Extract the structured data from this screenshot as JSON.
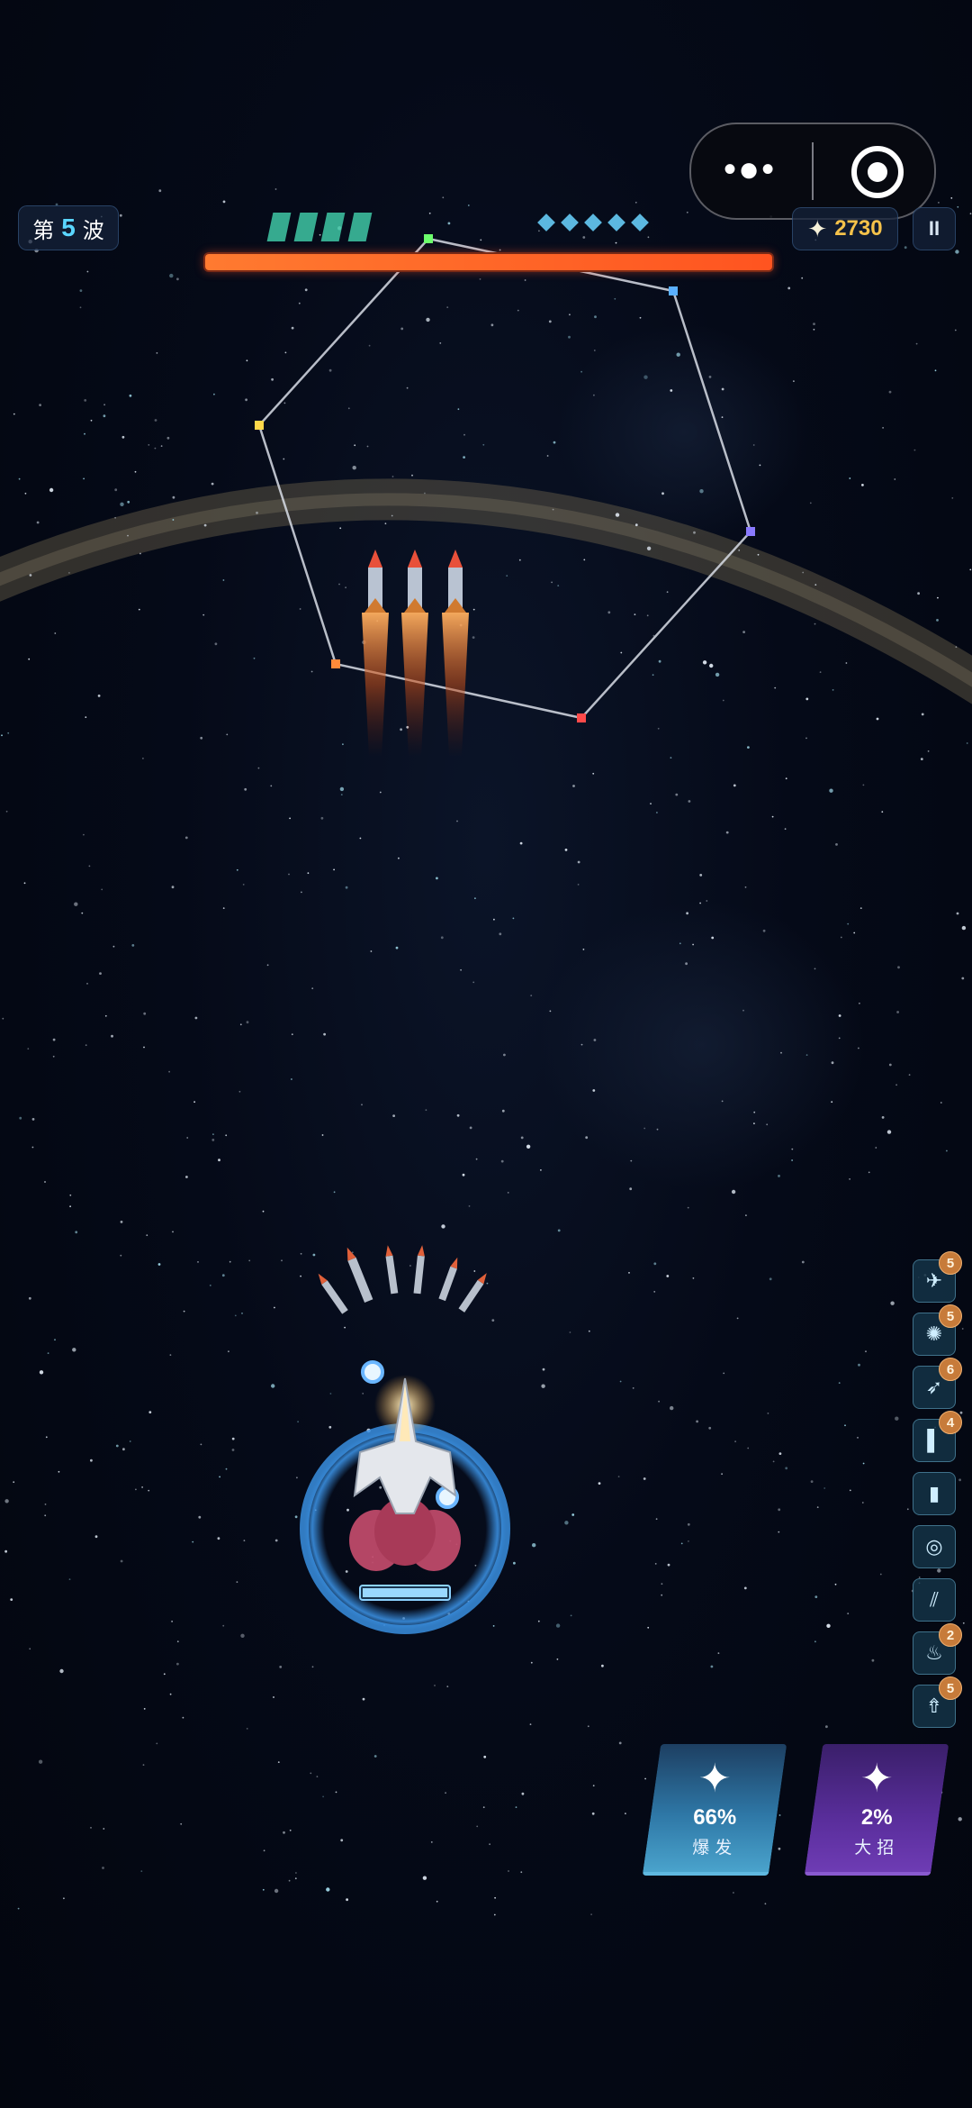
{
  "hud": {
    "wave_prefix": "第",
    "wave_number": "5",
    "wave_suffix": "波",
    "lives_count": 4,
    "shield_count": 5,
    "score": "2730",
    "score_icon": "sparkle-icon",
    "pause_label": "II",
    "boss_hp_fraction": 1.0,
    "boss_hp_color": "#ff5a24"
  },
  "miniprogram_capsule": {
    "menu_icon": "more-dots-icon",
    "close_icon": "target-circle-icon"
  },
  "skills": [
    {
      "icon": "drone-icon",
      "glyph": "✈",
      "level": "5"
    },
    {
      "icon": "burst-icon",
      "glyph": "✺",
      "level": "5"
    },
    {
      "icon": "missile-icon",
      "glyph": "➶",
      "level": "6"
    },
    {
      "icon": "laser-beam-icon",
      "glyph": "▌",
      "level": "4"
    },
    {
      "icon": "battery-icon",
      "glyph": "▮",
      "level": ""
    },
    {
      "icon": "shield-ring-icon",
      "glyph": "◎",
      "level": ""
    },
    {
      "icon": "slash-icon",
      "glyph": "⫽",
      "level": ""
    },
    {
      "icon": "flame-icon",
      "glyph": "♨",
      "level": "2"
    },
    {
      "icon": "ship-upgrade-icon",
      "glyph": "⇮",
      "level": "5"
    }
  ],
  "actions": {
    "burst": {
      "icon": "four-point-star-icon",
      "percent": "66%",
      "label": "爆发",
      "color": "#2e77a6"
    },
    "ultimate": {
      "icon": "four-point-star-icon",
      "percent": "2%",
      "label": "大招",
      "color": "#5a2e9c"
    }
  },
  "colors": {
    "background": "#03060f",
    "player_shield": "#3a8fe0",
    "accent_blue": "#5ad6ff",
    "score_gold": "#f5c24a"
  }
}
